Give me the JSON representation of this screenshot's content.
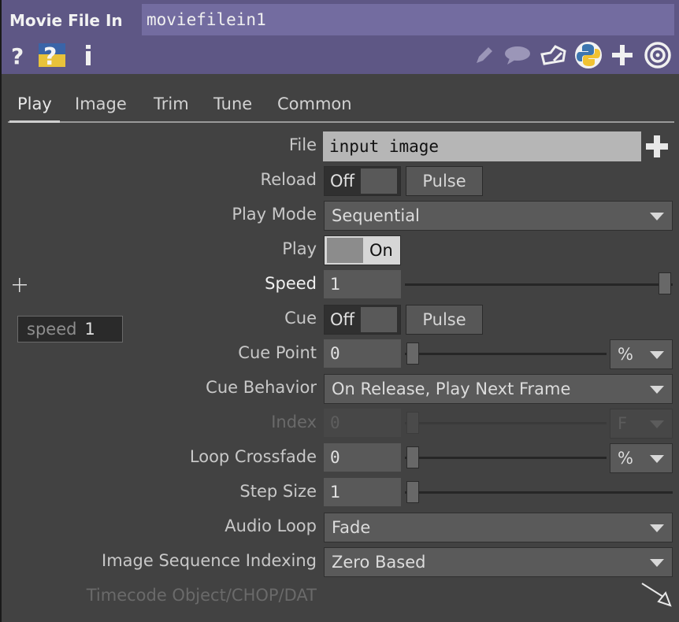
{
  "header": {
    "op_type": "Movie File In",
    "op_name": "moviefilein1",
    "icons_left": [
      "help-icon",
      "help-operator-icon",
      "info-icon"
    ],
    "icons_right": [
      "edit-icon",
      "comment-icon",
      "clone-icon",
      "python-icon",
      "add-icon",
      "target-icon"
    ]
  },
  "tabs": [
    {
      "label": "Play",
      "active": true
    },
    {
      "label": "Image"
    },
    {
      "label": "Trim"
    },
    {
      "label": "Tune"
    },
    {
      "label": "Common"
    }
  ],
  "params": {
    "file": {
      "label": "File",
      "value": "input image"
    },
    "reload": {
      "label": "Reload",
      "toggle": "Off",
      "pulse": "Pulse"
    },
    "play_mode": {
      "label": "Play Mode",
      "value": "Sequential"
    },
    "play": {
      "label": "Play",
      "toggle": "On"
    },
    "speed": {
      "label": "Speed",
      "value": "1"
    },
    "cue": {
      "label": "Cue",
      "toggle": "Off",
      "pulse": "Pulse"
    },
    "cue_point": {
      "label": "Cue Point",
      "value": "0",
      "unit": "%"
    },
    "cue_behavior": {
      "label": "Cue Behavior",
      "value": "On Release, Play Next Frame"
    },
    "index": {
      "label": "Index",
      "value": "0",
      "unit": "F"
    },
    "loop_crossfade": {
      "label": "Loop Crossfade",
      "value": "0",
      "unit": "%"
    },
    "step_size": {
      "label": "Step Size",
      "value": "1"
    },
    "audio_loop": {
      "label": "Audio Loop",
      "value": "Fade"
    },
    "image_seq_indexing": {
      "label": "Image Sequence Indexing",
      "value": "Zero Based"
    },
    "timecode": {
      "label": "Timecode Object/CHOP/DAT"
    }
  },
  "speed_readout": {
    "name": "speed",
    "value": "1"
  },
  "colors": {
    "header_bg": "#5e5785",
    "name_field_bg": "#736ca0",
    "panel_bg": "#424242"
  }
}
